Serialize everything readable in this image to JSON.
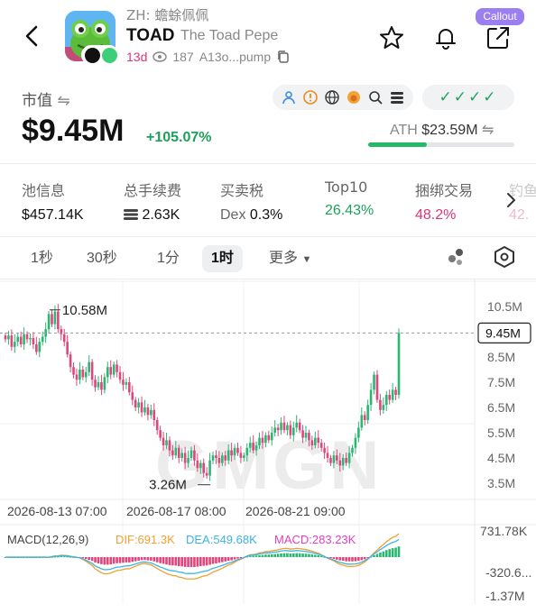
{
  "header": {
    "zh_name": "ZH: 蟾蜍佩佩",
    "ticker": "TOAD",
    "full_name": "The Toad Pepe",
    "age": "13d",
    "views": "187",
    "address": "A13o...pump",
    "callout_label": "Callout"
  },
  "market": {
    "label": "市值",
    "value": "$9.45M",
    "change": "+105.07%",
    "checks": "✓✓✓✓",
    "ath_label": "ATH",
    "ath_value": "$23.59M",
    "ath_progress": 0.4
  },
  "stats": [
    {
      "key": "池信息",
      "value": "$457.14K"
    },
    {
      "key": "总手续费",
      "value": "2.63K"
    },
    {
      "key": "买卖税",
      "value_prefix": "Dex",
      "value": "0.3%"
    },
    {
      "key": "Top10",
      "value": "26.43%"
    },
    {
      "key": "捆绑交易",
      "value": "48.2%"
    },
    {
      "key": "钓鱼",
      "value": "42."
    }
  ],
  "tabs": [
    "1秒",
    "30秒",
    "1分",
    "1时",
    "更多"
  ],
  "active_tab": 3,
  "chart_data": {
    "type": "candlestick",
    "price_axis_ticks": [
      "10.5M",
      "9.45M",
      "8.5M",
      "7.5M",
      "6.5M",
      "5.5M",
      "4.5M",
      "3.5M"
    ],
    "price_ticks_values": [
      10.5,
      8.5,
      7.5,
      6.5,
      5.5,
      4.5,
      3.5
    ],
    "current_price": 9.45,
    "current_price_label": "9.45M",
    "high_label": "10.58M",
    "low_label": "3.26M",
    "high_value": 10.58,
    "low_value": 3.26,
    "x_labels": [
      "2026-08-13 07:00",
      "2026-08-17 08:00",
      "2026-08-21 09:00"
    ],
    "close_series": [
      9.2,
      9.35,
      8.9,
      9.1,
      9.3,
      9.0,
      9.4,
      9.2,
      9.25,
      9.0,
      8.7,
      9.1,
      9.3,
      9.6,
      10.2,
      9.8,
      10.3,
      9.6,
      9.4,
      9.1,
      8.6,
      8.1,
      7.8,
      7.6,
      8.0,
      7.7,
      7.9,
      8.3,
      7.6,
      7.3,
      7.5,
      7.2,
      7.7,
      8.1,
      7.8,
      8.2,
      7.9,
      7.6,
      7.4,
      7.5,
      7.1,
      6.8,
      6.5,
      6.7,
      6.3,
      6.5,
      6.2,
      6.4,
      6.0,
      5.6,
      5.3,
      5.0,
      5.2,
      4.8,
      4.6,
      4.9,
      4.5,
      4.7,
      4.3,
      4.5,
      4.8,
      4.4,
      4.1,
      4.3,
      3.9,
      3.8,
      4.4,
      4.6,
      4.5,
      4.3,
      4.6,
      4.4,
      4.8,
      4.6,
      4.9,
      4.7,
      4.5,
      4.6,
      4.9,
      5.1,
      4.8,
      5.0,
      5.3,
      5.1,
      5.4,
      5.2,
      5.5,
      5.7,
      5.6,
      5.9,
      5.6,
      5.8,
      5.4,
      5.7,
      5.9,
      5.6,
      5.3,
      5.5,
      5.2,
      5.0,
      5.3,
      5.1,
      4.9,
      4.7,
      4.5,
      4.3,
      4.6,
      4.4,
      4.2,
      4.5,
      4.3,
      4.7,
      4.9,
      5.3,
      5.7,
      6.2,
      6.0,
      6.6,
      7.2,
      7.8,
      6.8,
      6.4,
      6.6,
      7.0,
      6.8,
      7.2,
      7.0,
      9.45
    ],
    "macd": {
      "label": "MACD(12,26,9)",
      "dif_label": "DIF:691.3K",
      "dea_label": "DEA:549.68K",
      "macd_label": "MACD:283.23K",
      "axis_ticks": [
        "731.78K",
        "-320.6...",
        "-1.37M"
      ],
      "dif_color": "#f0a030",
      "dea_color": "#3cb4e6",
      "macd_color": "#e040c0"
    },
    "watermark": "GMGN"
  },
  "colors": {
    "up": "#2bb673",
    "down": "#e0457b",
    "accent_purple": "#9b7ef0"
  }
}
